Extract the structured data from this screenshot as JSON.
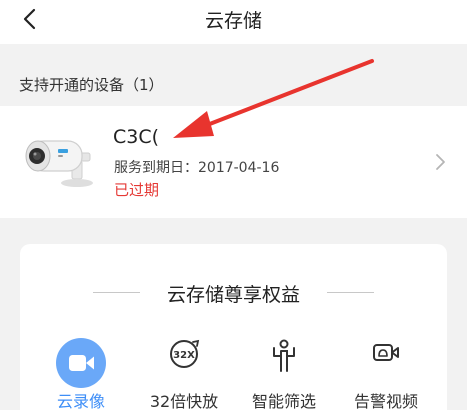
{
  "nav": {
    "title": "云存储"
  },
  "section": {
    "label": "支持开通的设备（1）"
  },
  "device": {
    "name": "C3C(",
    "expiry": "服务到期日：2017-04-16",
    "status": "已过期"
  },
  "benefits": {
    "title": "云存储尊享权益",
    "features": [
      {
        "label": "云录像",
        "icon": "video-camera-icon",
        "active": true
      },
      {
        "label": "32倍快放",
        "icon": "speed-32x-icon",
        "active": false
      },
      {
        "label": "智能筛选",
        "icon": "person-filter-icon",
        "active": false
      },
      {
        "label": "告警视频",
        "icon": "alarm-video-icon",
        "active": false
      }
    ]
  },
  "colors": {
    "accent": "#3e8ef7",
    "expired": "#e53935",
    "annotation": "#e8342e"
  }
}
